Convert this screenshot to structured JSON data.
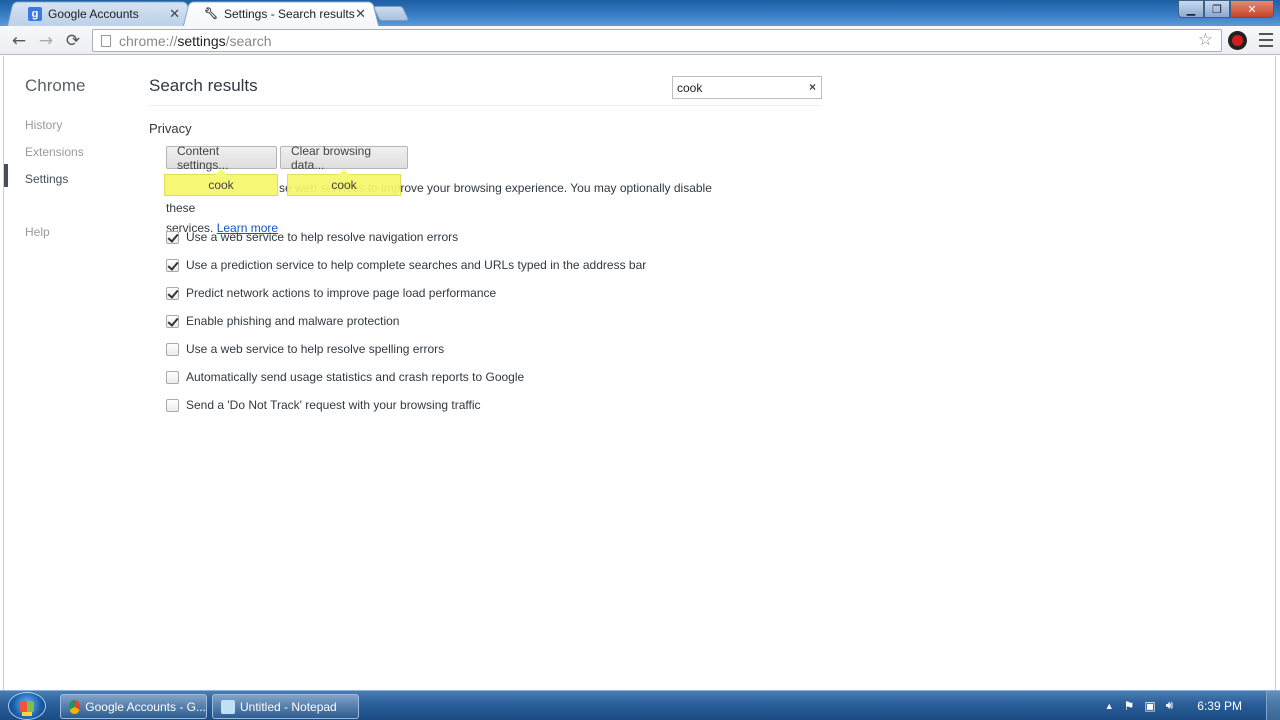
{
  "window": {
    "tabs": [
      {
        "label": "Google Accounts",
        "favicon": "google-g-icon",
        "active": false
      },
      {
        "label": "Settings - Search results",
        "favicon": "wrench-icon",
        "active": true
      }
    ],
    "controls": {
      "minimize": "▁",
      "maximize": "❐",
      "close": "✕"
    }
  },
  "toolbar": {
    "url_scheme": "chrome://",
    "url_host": "settings",
    "url_path": "/search",
    "back": "←",
    "forward": "→",
    "reload": "⟳",
    "star": "☆"
  },
  "sidebar": {
    "title": "Chrome",
    "items": [
      {
        "label": "History",
        "selected": false
      },
      {
        "label": "Extensions",
        "selected": false
      },
      {
        "label": "Settings",
        "selected": true
      },
      {
        "label": "Help",
        "selected": false
      }
    ]
  },
  "main": {
    "title": "Search results",
    "search": {
      "value": "cook",
      "clear": "×"
    },
    "section_title": "Privacy",
    "buttons": {
      "content_settings": "Content settings...",
      "clear_browsing_data": "Clear browsing data..."
    },
    "highlights": [
      "cook",
      "cook"
    ],
    "description_visible": "se web services to improve your browsing experience. You may optionally disable these",
    "description_line2": "services.",
    "learn_more": "Learn more",
    "options": [
      {
        "label": "Use a web service to help resolve navigation errors",
        "checked": true
      },
      {
        "label": "Use a prediction service to help complete searches and URLs typed in the address bar",
        "checked": true
      },
      {
        "label": "Predict network actions to improve page load performance",
        "checked": true
      },
      {
        "label": "Enable phishing and malware protection",
        "checked": true
      },
      {
        "label": "Use a web service to help resolve spelling errors",
        "checked": false
      },
      {
        "label": "Automatically send usage statistics and crash reports to Google",
        "checked": false
      },
      {
        "label": "Send a 'Do Not Track' request with your browsing traffic",
        "checked": false
      }
    ]
  },
  "taskbar": {
    "items": [
      {
        "label": "Google Accounts - G...",
        "icon": "chrome-icon"
      },
      {
        "label": "Untitled - Notepad",
        "icon": "notepad-icon"
      }
    ],
    "tray": {
      "arrow": "▲",
      "clock": "6:39 PM"
    }
  },
  "colors": {
    "link": "#1155cc",
    "highlight": "#f7f76c",
    "titlebar": "#3a7fc6"
  }
}
